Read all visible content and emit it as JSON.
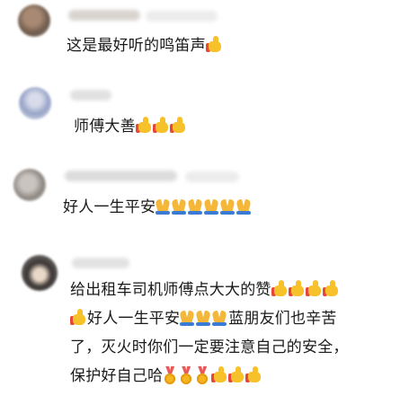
{
  "comments": [
    {
      "text": "这是最好听的鸣笛声",
      "emojis": [
        "thumbs-up"
      ]
    },
    {
      "text": "师傅大善",
      "emojis": [
        "thumbs-up",
        "thumbs-up",
        "thumbs-up"
      ]
    },
    {
      "text": "好人一生平安",
      "emojis": [
        "folded-hands",
        "folded-hands",
        "folded-hands",
        "folded-hands",
        "folded-hands",
        "folded-hands"
      ]
    },
    {
      "lines": [
        "给出租车司机师傅点大大的赞",
        "好人一生平安",
        "蓝朋友们也辛苦",
        "了，灭火时你们一定要注意自己的安全，",
        "保护好自己哈"
      ]
    }
  ],
  "colors": {
    "thumb": "#f7c12b",
    "background": "#ffffff",
    "text": "#1a1a1a"
  }
}
